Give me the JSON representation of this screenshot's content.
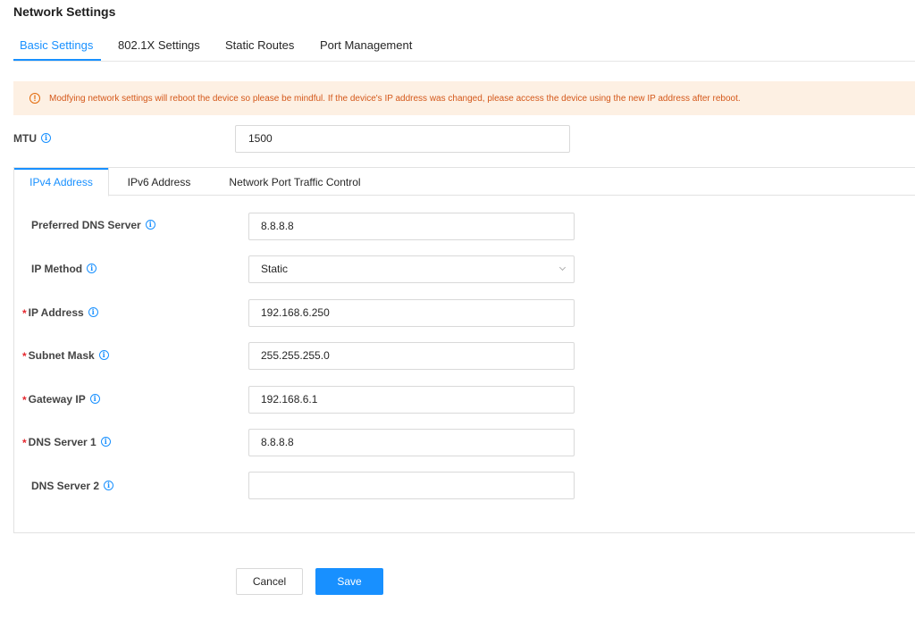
{
  "page": {
    "title": "Network Settings"
  },
  "tabs": [
    {
      "label": "Basic Settings",
      "active": true
    },
    {
      "label": "802.1X Settings",
      "active": false
    },
    {
      "label": "Static Routes",
      "active": false
    },
    {
      "label": "Port Management",
      "active": false
    }
  ],
  "alert": {
    "icon": "exclamation-circle-icon",
    "text": "Modfying network settings will reboot the device so please be mindful. If the device's IP address was changed, please access the device using the new IP address after reboot."
  },
  "mtu": {
    "label": "MTU",
    "value": "1500"
  },
  "sub_tabs": [
    {
      "label": "IPv4 Address",
      "active": true
    },
    {
      "label": "IPv6 Address",
      "active": false
    },
    {
      "label": "Network Port Traffic Control",
      "active": false
    }
  ],
  "ipv4": {
    "preferred_dns": {
      "label": "Preferred DNS Server",
      "value": "8.8.8.8",
      "required": false
    },
    "ip_method": {
      "label": "IP Method",
      "value": "Static",
      "required": false
    },
    "ip_address": {
      "label": "IP Address",
      "value": "192.168.6.250",
      "required": true
    },
    "subnet_mask": {
      "label": "Subnet Mask",
      "value": "255.255.255.0",
      "required": true
    },
    "gateway_ip": {
      "label": "Gateway IP",
      "value": "192.168.6.1",
      "required": true
    },
    "dns1": {
      "label": "DNS Server 1",
      "value": "8.8.8.8",
      "required": true
    },
    "dns2": {
      "label": "DNS Server 2",
      "value": "",
      "required": false
    }
  },
  "required_mark": "*",
  "info_glyph": "i",
  "alert_glyph": "!",
  "buttons": {
    "cancel": "Cancel",
    "save": "Save"
  },
  "colors": {
    "accent": "#1890ff",
    "warning_bg": "#fdf0e3",
    "warning_text": "#d4581a",
    "required": "#e5282f"
  }
}
